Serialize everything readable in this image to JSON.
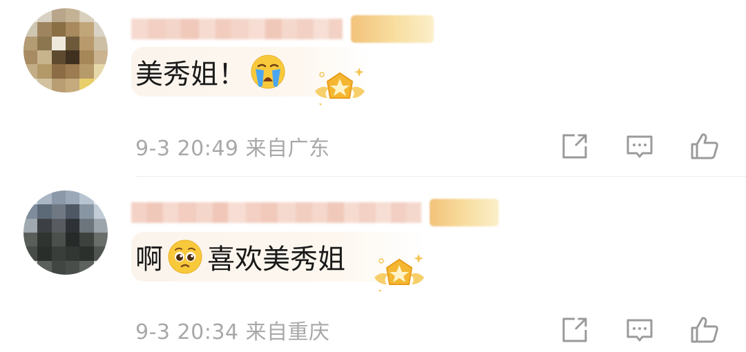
{
  "comments": [
    {
      "text": "美秀姐！",
      "emoji": "loudly-crying-face-emoji",
      "time": "9-3 20:49",
      "location": "来自广东",
      "actions": [
        "share-icon",
        "comment-icon",
        "like-icon"
      ],
      "medal": "gold-star-medal-icon"
    },
    {
      "text_before": "啊",
      "emoji": "pleading-face-emoji",
      "text_after": "喜欢美秀姐",
      "time": "9-3 20:34",
      "location": "来自重庆",
      "actions": [
        "share-icon",
        "comment-icon",
        "like-icon"
      ],
      "medal": "gold-star-medal-icon"
    }
  ],
  "colors": {
    "meta_text": "#a8a8a8",
    "body_text": "#1a1a1a",
    "bubble_bg": "#fbf4ec",
    "icon_stroke": "#9a9a9a",
    "medal_gold": "#f5b731"
  }
}
